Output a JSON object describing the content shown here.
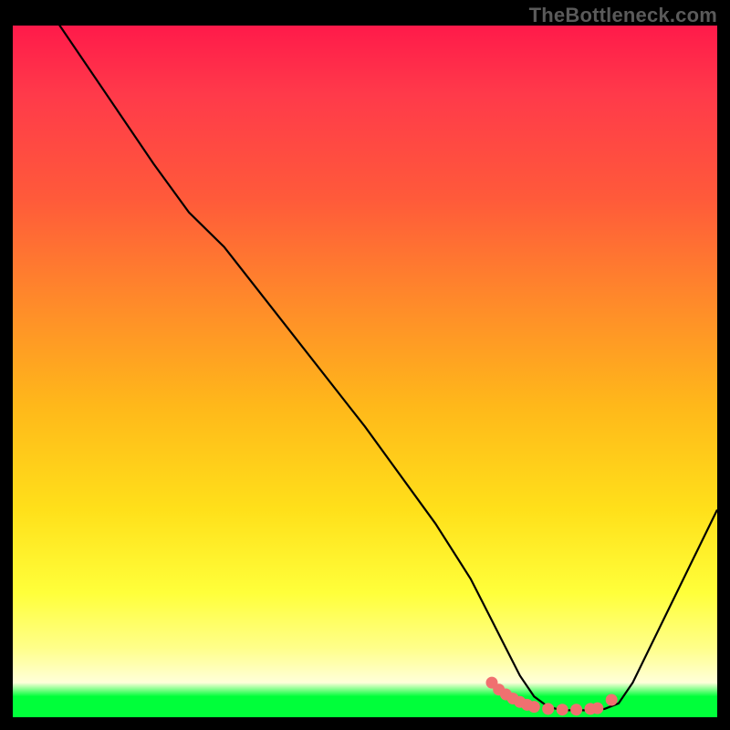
{
  "watermark": "TheBottleneck.com",
  "chart_data": {
    "type": "line",
    "title": "",
    "xlabel": "",
    "ylabel": "",
    "xlim": [
      0,
      100
    ],
    "ylim": [
      0,
      100
    ],
    "series": [
      {
        "name": "curve",
        "x": [
          0,
          10,
          20,
          25,
          30,
          40,
          50,
          60,
          65,
          68,
          70,
          72,
          74,
          76,
          78,
          80,
          82,
          84,
          86,
          88,
          100
        ],
        "y": [
          110,
          95,
          80,
          73,
          68,
          55,
          42,
          28,
          20,
          14,
          10,
          6,
          3,
          1.5,
          1,
          1,
          1,
          1.2,
          2,
          5,
          30
        ]
      }
    ],
    "highlight_points": {
      "name": "salmon-dots",
      "color": "#f07070",
      "x": [
        68,
        69,
        70,
        71,
        72,
        73,
        74,
        76,
        78,
        80,
        82,
        83,
        85
      ],
      "y": [
        5,
        4,
        3.3,
        2.7,
        2.2,
        1.8,
        1.5,
        1.2,
        1.1,
        1.1,
        1.2,
        1.3,
        2.5
      ]
    }
  }
}
